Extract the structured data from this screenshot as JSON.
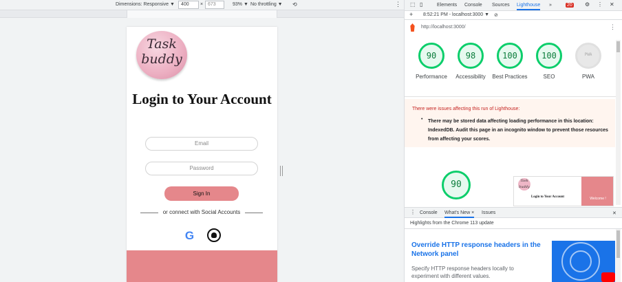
{
  "device_toolbar": {
    "dimensions_label": "Dimensions: Responsive ▼",
    "width": "400",
    "times": "×",
    "height": "673",
    "zoom": "93% ▼",
    "throttle": "No throttling ▼"
  },
  "app": {
    "logo_line1": "Task",
    "logo_line2": "buddy",
    "title": "Login to Your Account",
    "email_placeholder": "Email",
    "password_placeholder": "Password",
    "signin_label": "Sign In",
    "social_text": "or connect with Social Accounts",
    "google_glyph": "G"
  },
  "devtools": {
    "tabs": [
      "Elements",
      "Console",
      "Sources",
      "Lighthouse",
      "»"
    ],
    "issues_count": "20",
    "report_time": "8:52:21 PM - localhost:3000 ▼",
    "url": "http://localhost:3000/",
    "scores": [
      {
        "value": "90",
        "label": "Performance"
      },
      {
        "value": "98",
        "label": "Accessibility"
      },
      {
        "value": "100",
        "label": "Best Practices"
      },
      {
        "value": "100",
        "label": "SEO"
      },
      {
        "value": "PWA",
        "label": "PWA"
      }
    ],
    "warning_head": "There were issues affecting this run of Lighthouse:",
    "warning_body": "There may be stored data affecting loading performance in this location: IndexedDB. Audit this page in an incognito window to prevent those resources from affecting your scores.",
    "big_score": "90",
    "thumb_logo": "Task buddy",
    "thumb_title": "Login to Your Account",
    "thumb_welcome": "Welcome !",
    "drawer_tabs": [
      "Console",
      "What's New ×",
      "Issues"
    ],
    "drawer_highlight": "Highlights from the Chrome 113 update",
    "news_title": "Override HTTP response headers in the Network panel",
    "news_body": "Specify HTTP response headers locally to experiment with different values."
  }
}
